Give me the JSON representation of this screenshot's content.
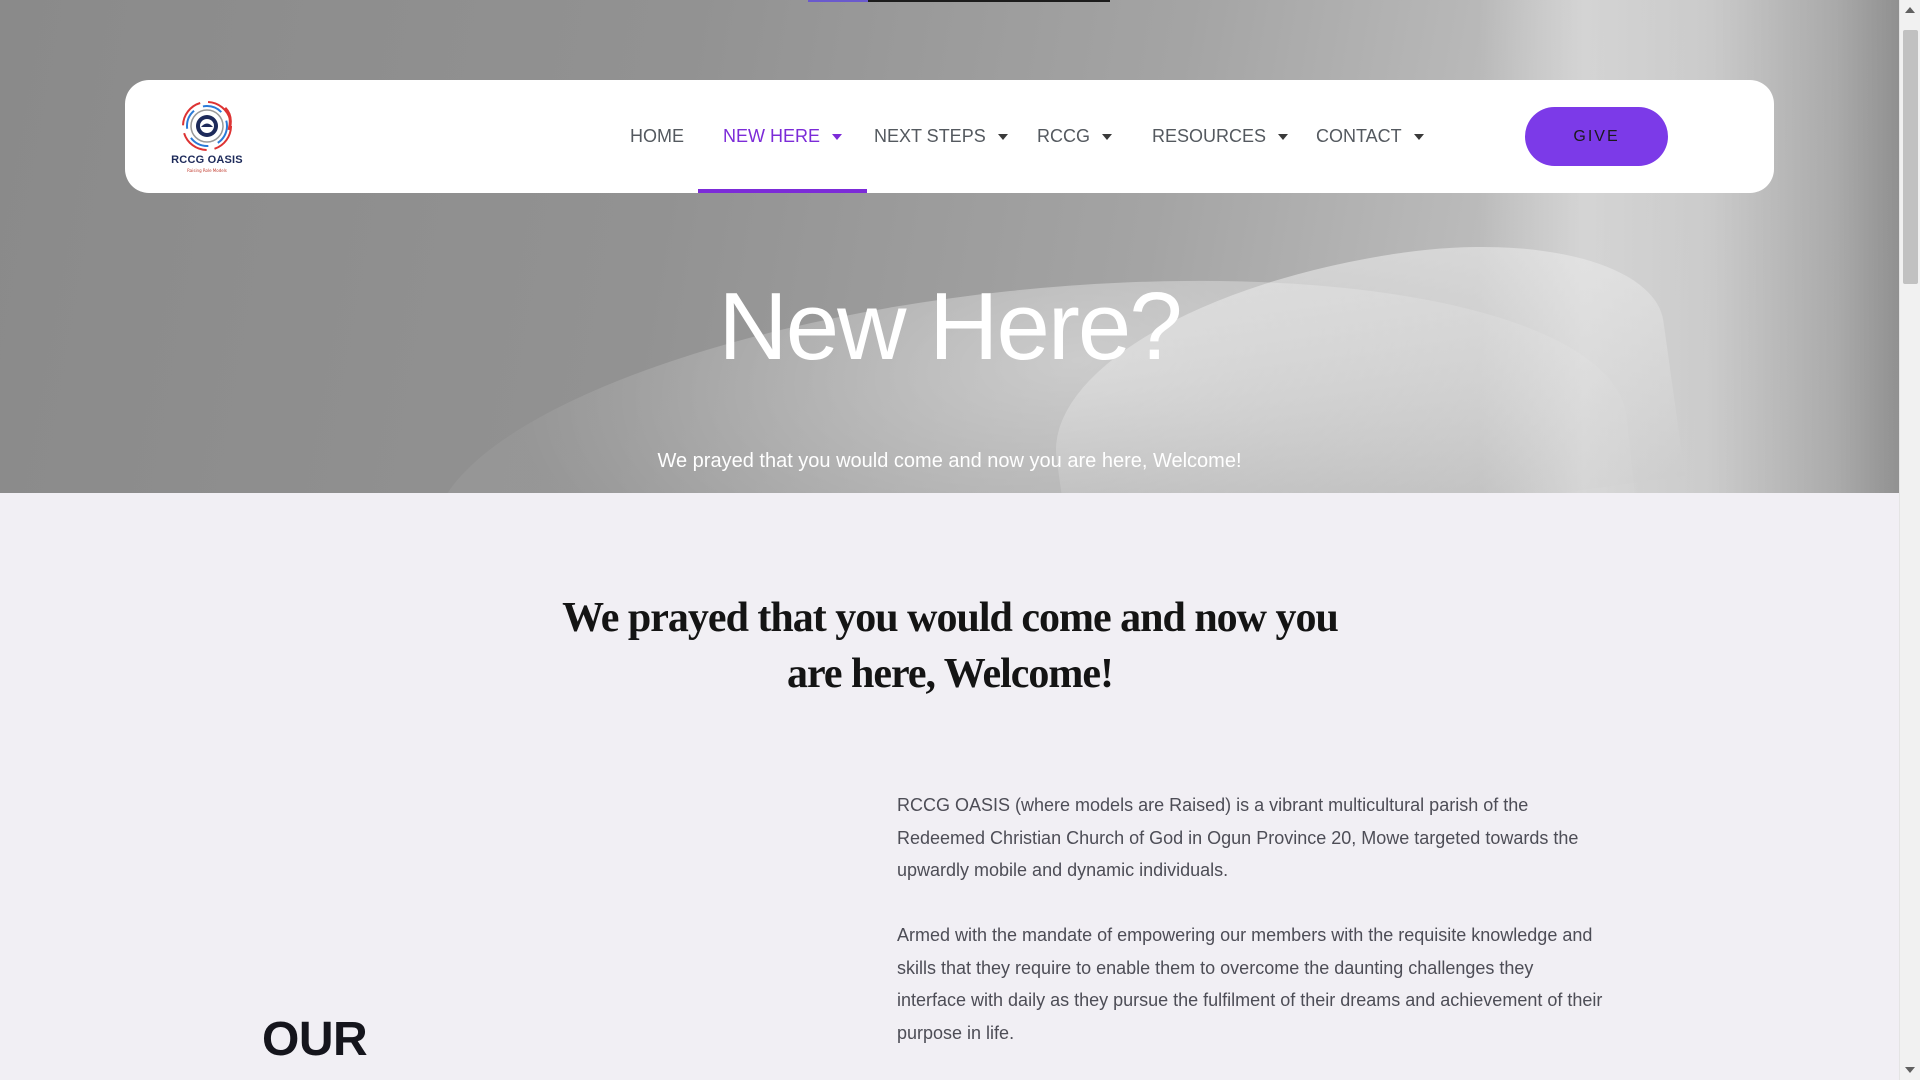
{
  "brand": {
    "name": "RCCG OASIS",
    "tagline": "Raising Role Models"
  },
  "nav": {
    "items": [
      {
        "label": "HOME",
        "has_dropdown": false,
        "active": false
      },
      {
        "label": "NEW HERE",
        "has_dropdown": true,
        "active": true
      },
      {
        "label": "NEXT STEPS",
        "has_dropdown": true,
        "active": false
      },
      {
        "label": "RCCG",
        "has_dropdown": true,
        "active": false
      },
      {
        "label": "RESOURCES",
        "has_dropdown": true,
        "active": false
      },
      {
        "label": "CONTACT",
        "has_dropdown": true,
        "active": false
      }
    ],
    "give_label": "GIVE"
  },
  "hero": {
    "title": "New Here?",
    "subtitle": "We prayed that you would come and now you are here, Welcome!"
  },
  "main": {
    "heading": "We prayed that you would come and now you are here, Welcome!",
    "paragraphs": [
      "RCCG OASIS (where models are Raised) is a vibrant multicultural parish of the Redeemed Christian Church of God in Ogun Province 20, Mowe targeted towards the upwardly mobile and dynamic individuals.",
      "Armed with the mandate of empowering our members with the requisite knowledge and skills that they require to enable them to overcome the daunting challenges they interface with daily as they pursue the fulfilment of their dreams and achievement of their purpose in life."
    ],
    "section_heading": "OUR"
  },
  "colors": {
    "accent": "#7c2bd8",
    "give_button": "#7c3ae8",
    "page_background": "#f1eff4",
    "nav_text": "#54595f"
  }
}
